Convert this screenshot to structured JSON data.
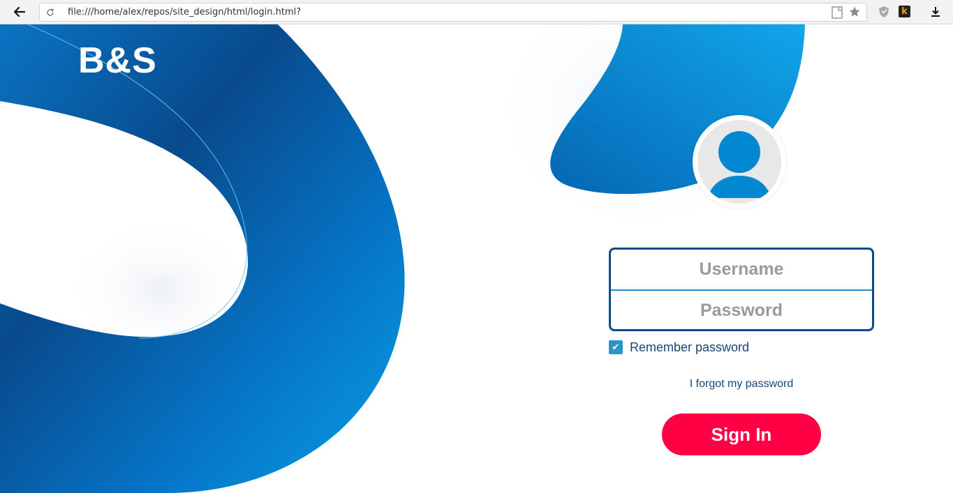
{
  "browser": {
    "url": "file:///home/alex/repos/site_design/html/login.html?",
    "icons": [
      "back-arrow-icon",
      "reload-icon",
      "page-icon",
      "star-icon",
      "shield-icon",
      "k-extension-icon",
      "download-icon"
    ],
    "extension_k_label": "k"
  },
  "brand": {
    "logo": "B&S",
    "colors": {
      "primary_dark": "#0a4a8a",
      "primary": "#0288d1",
      "accent": "#ff0045"
    }
  },
  "login": {
    "username_placeholder": "Username",
    "password_placeholder": "Password",
    "remember_label": "Remember password",
    "remember_checked": true,
    "checkbox_mark": "✔",
    "forgot_link": "I forgot my password",
    "signin_label": "Sign In"
  }
}
